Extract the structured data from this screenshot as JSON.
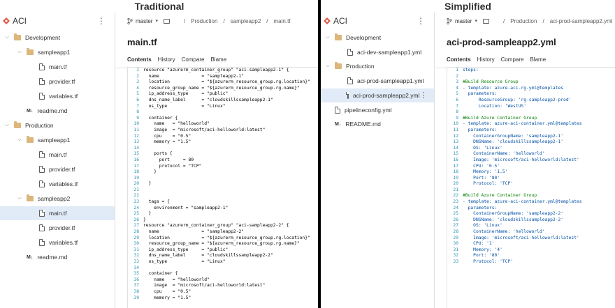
{
  "captions": {
    "left": "Traditional",
    "right": "Simplified"
  },
  "colors": {
    "accent": "#0078d4",
    "selected_row": "#e1ebf7",
    "folder": "#dcb67a",
    "project_logo": "#e05a47"
  },
  "left": {
    "sidebar": {
      "title": "ACI",
      "more": "⋮",
      "items": [
        {
          "label": "Development",
          "kind": "folder",
          "level": 0,
          "expanded": true
        },
        {
          "label": "sampleapp1",
          "kind": "folder",
          "level": 1,
          "expanded": true
        },
        {
          "label": "main.tf",
          "kind": "file",
          "level": 2
        },
        {
          "label": "provider.tf",
          "kind": "file",
          "level": 2
        },
        {
          "label": "variables.tf",
          "kind": "file",
          "level": 2
        },
        {
          "label": "readme.md",
          "kind": "md",
          "level": 1
        },
        {
          "label": "Production",
          "kind": "folder",
          "level": 0,
          "expanded": true
        },
        {
          "label": "sampleapp1",
          "kind": "folder",
          "level": 1,
          "expanded": true
        },
        {
          "label": "main.tf",
          "kind": "file",
          "level": 2
        },
        {
          "label": "provider.tf",
          "kind": "file",
          "level": 2
        },
        {
          "label": "variables.tf",
          "kind": "file",
          "level": 2
        },
        {
          "label": "sampleapp2",
          "kind": "folder",
          "level": 1,
          "expanded": true
        },
        {
          "label": "main.tf",
          "kind": "file",
          "level": 2,
          "selected": true
        },
        {
          "label": "provider.tf",
          "kind": "file",
          "level": 2
        },
        {
          "label": "variables.tf",
          "kind": "file",
          "level": 2
        },
        {
          "label": "readme.md",
          "kind": "md",
          "level": 1
        }
      ]
    },
    "breadcrumb": {
      "branch": "master",
      "path": [
        "Production",
        "sampleapp2",
        "main.tf"
      ]
    },
    "file_title": "main.tf",
    "tabs": [
      "Contents",
      "History",
      "Compare",
      "Blame"
    ],
    "active_tab": 0,
    "code": [
      "resource \"azurerm_container_group\" \"aci-sampleapp2-1\" {",
      "  name                = \"sampleapp2-1\"",
      "  location            = \"${azurerm_resource_group.rg.location}\"",
      "  resource_group_name = \"${azurerm_resource_group.rg.name}\"",
      "  ip_address_type     = \"public\"",
      "  dns_name_label      = \"cloudskillssampleapp2-1\"",
      "  os_type             = \"Linux\"",
      "",
      "  container {",
      "    name   = \"helloworld\"",
      "    image  = \"microsoft/aci-helloworld:latest\"",
      "    cpu    = \"0.5\"",
      "    memory = \"1.5\"",
      "",
      "    ports {",
      "      port     = 80",
      "      protocol = \"TCP\"",
      "    }",
      "",
      "  }",
      "",
      "",
      "  tags = {",
      "    environment = \"sampleapp2-1\"",
      "  }",
      "}",
      "resource \"azurerm_container_group\" \"aci-sampleapp2-2\" {",
      "  name                = \"sampleapp2-2\"",
      "  location            = \"${azurerm_resource_group.rg.location}\"",
      "  resource_group_name = \"${azurerm_resource_group.rg.name}\"",
      "  ip_address_type     = \"public\"",
      "  dns_name_label      = \"cloudskillssampleapp2-2\"",
      "  os_type             = \"Linux\"",
      "",
      "  container {",
      "    name   = \"helloworld\"",
      "    image  = \"microsoft/aci-helloworld:latest\"",
      "    cpu    = \"0.5\"",
      "    memory = \"1.5\""
    ]
  },
  "right": {
    "sidebar": {
      "title": "ACI",
      "more": "⋮",
      "items": [
        {
          "label": "Development",
          "kind": "folder",
          "level": 0,
          "expanded": true
        },
        {
          "label": "aci-dev-sampleapp1.yml",
          "kind": "file",
          "level": 1
        },
        {
          "label": "Production",
          "kind": "folder",
          "level": 0,
          "expanded": true
        },
        {
          "label": "aci-prod-sampleapp1.yml",
          "kind": "file",
          "level": 1
        },
        {
          "label": "aci-prod-sampleapp2.yml",
          "kind": "file",
          "level": 1,
          "selected": true
        },
        {
          "label": "pipelineconfig.yml",
          "kind": "file",
          "level": 0
        },
        {
          "label": "README.md",
          "kind": "md",
          "level": 0
        }
      ]
    },
    "breadcrumb": {
      "branch": "master",
      "path": [
        "Production",
        "aci-prod-sampleapp2.yml"
      ]
    },
    "file_title": "aci-prod-sampleapp2.yml",
    "tabs": [
      "Contents",
      "History",
      "Compare",
      "Blame"
    ],
    "active_tab": 0,
    "code": [
      "steps:",
      "",
      "#Build Resource Group",
      "- template: azure-aci-rg.yml@templates",
      "  parameters:",
      "      ResourceGroup: 'rg-sampleapp2-prod'",
      "      Location: 'WestUS'",
      "",
      "#Build Azure Container Group",
      "- template: azure-aci-container.yml@templates",
      "  parameters:",
      "    ContainerGroupName: 'sampleapp2-1'",
      "    DNSName: 'cloudskillssampleapp2-1'",
      "    OS: 'Linux'",
      "    ContainerName: 'helloworld'",
      "    Image: 'microsoft/aci-helloworld:latest'",
      "    CPU: '0.5'",
      "    Memory: '1.5'",
      "    Port: '80'",
      "    Protocol: 'TCP'",
      "",
      "#Build Azure Container Group",
      "- template: azure-aci-container.yml@templates",
      "  parameters:",
      "    ContainerGroupName: 'sampleapp2-2'",
      "    DNSName: 'cloudskillssampleapp2-2'",
      "    OS: 'Linux'",
      "    ContainerName: 'helloworld'",
      "    Image: 'microsoft/aci-helloworld:latest'",
      "    CPU: '1'",
      "    Memory: '4'",
      "    Port: '80'",
      "    Protocol: 'TCP'"
    ]
  }
}
